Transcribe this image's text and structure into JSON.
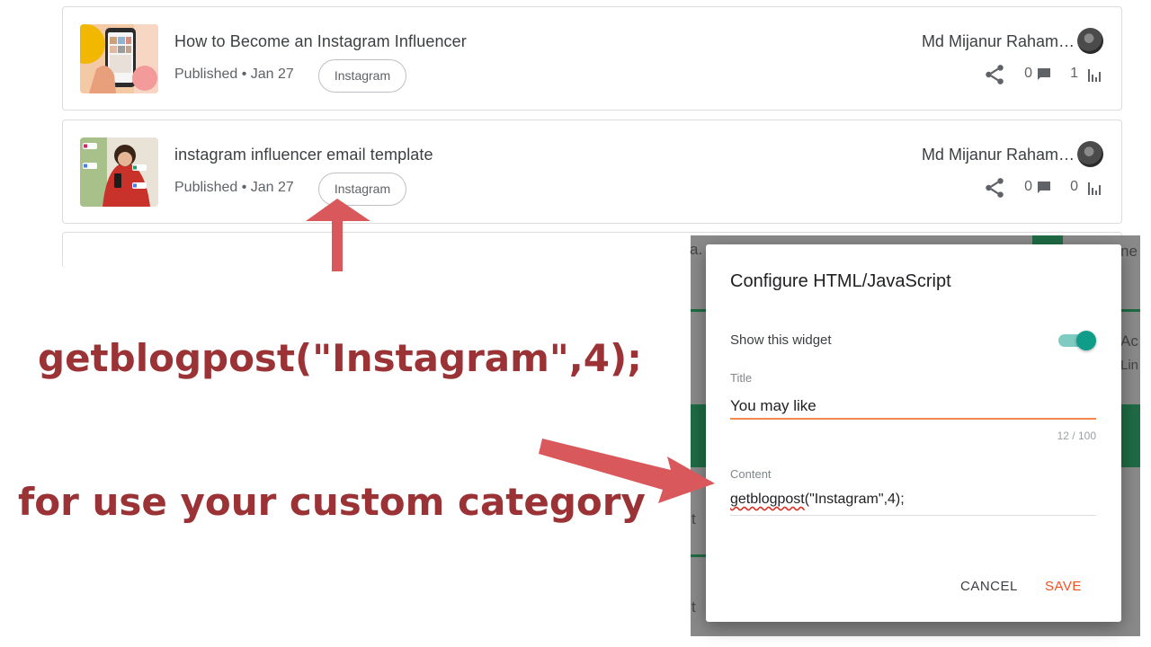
{
  "posts": [
    {
      "title": "How to Become an Instagram Influencer",
      "meta": "Published • Jan 27",
      "label": "Instagram",
      "author": "Md Mijanur Raham…",
      "comments": "0",
      "views": "1"
    },
    {
      "title": "instagram influencer email template",
      "meta": "Published • Jan 27",
      "label": "Instagram",
      "author": "Md Mijanur Raham…",
      "comments": "0",
      "views": "0"
    }
  ],
  "background": {
    "fragments": [
      "a.",
      "ne",
      "Ac",
      "Lin",
      "t",
      "t"
    ]
  },
  "dialog": {
    "title": "Configure HTML/JavaScript",
    "toggle_label": "Show this widget",
    "toggle_on": true,
    "title_field_label": "Title",
    "title_value": "You may like",
    "char_counter": "12 / 100",
    "content_field_label": "Content",
    "content_fn": "getblogpost",
    "content_args": "(\"Instagram\",4);",
    "cancel_label": "CANCEL",
    "save_label": "SAVE"
  },
  "annotations": {
    "code_line": "getblogpost(\"Instagram\",4);",
    "caption": "for use your custom category"
  },
  "colors": {
    "accent_orange": "#f4511e",
    "toggle_teal": "#0f9d8a",
    "annotation_red": "#9b3336",
    "arrow_red": "#d9585c"
  }
}
